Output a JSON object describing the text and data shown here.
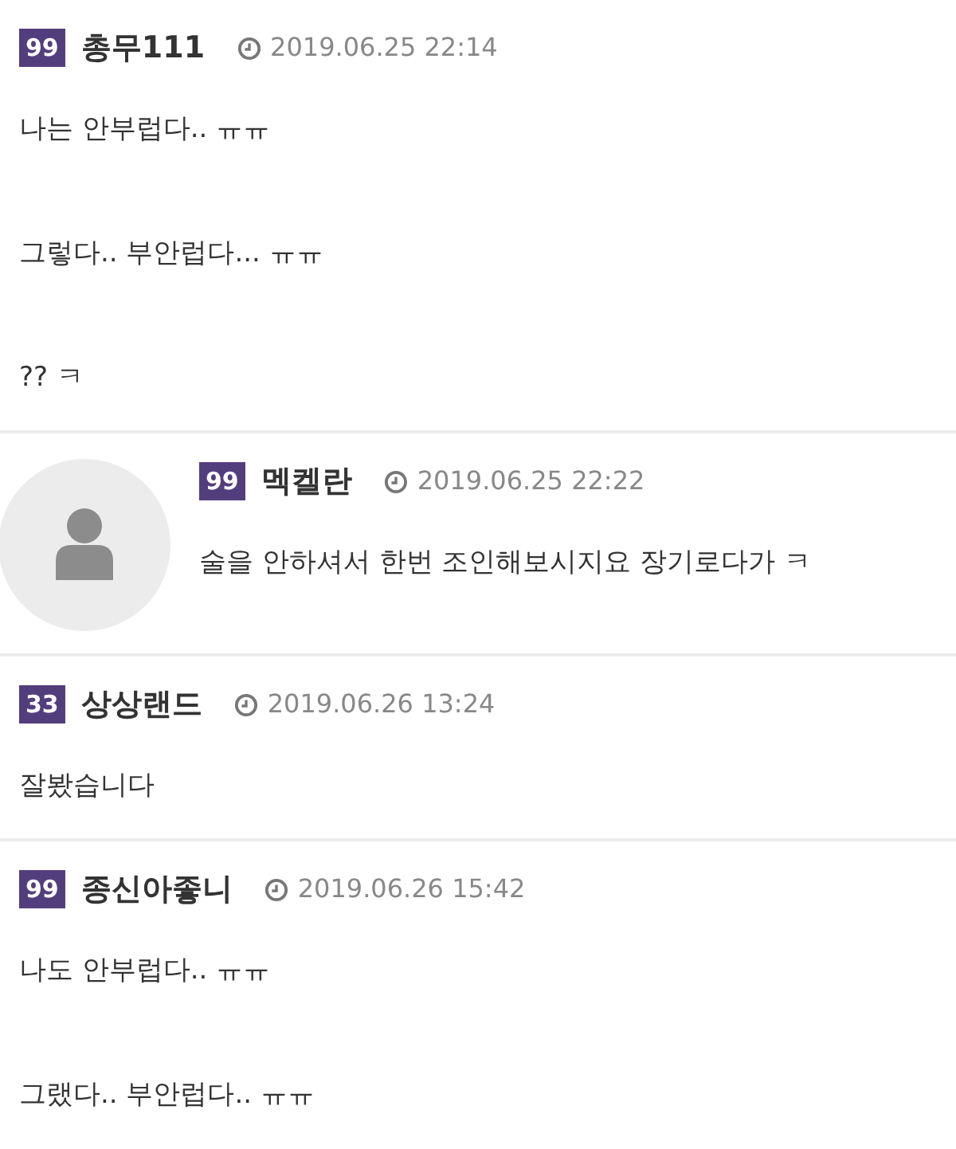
{
  "comments": [
    {
      "kind": "comment",
      "level": "99",
      "author": "총무111",
      "time": "2019.06.25 22:14",
      "paragraphs": [
        "나는 안부럽다.. ㅠㅠ",
        "그렇다.. 부안럽다... ㅠㅠ",
        "?? ㅋ"
      ]
    },
    {
      "kind": "reply",
      "level": "99",
      "author": "멕켈란",
      "time": "2019.06.25 22:22",
      "paragraphs": [
        "술을 안하셔서 한번 조인해보시지요 장기로다가 ㅋ"
      ]
    },
    {
      "kind": "comment",
      "level": "33",
      "author": "상상랜드",
      "time": "2019.06.26 13:24",
      "paragraphs": [
        "잘봤습니다"
      ]
    },
    {
      "kind": "comment",
      "level": "99",
      "author": "종신아좋니",
      "time": "2019.06.26 15:42",
      "paragraphs": [
        "나도 안부럽다.. ㅠㅠ",
        "그랬다.. 부안럽다.. ㅠㅠ"
      ]
    }
  ]
}
